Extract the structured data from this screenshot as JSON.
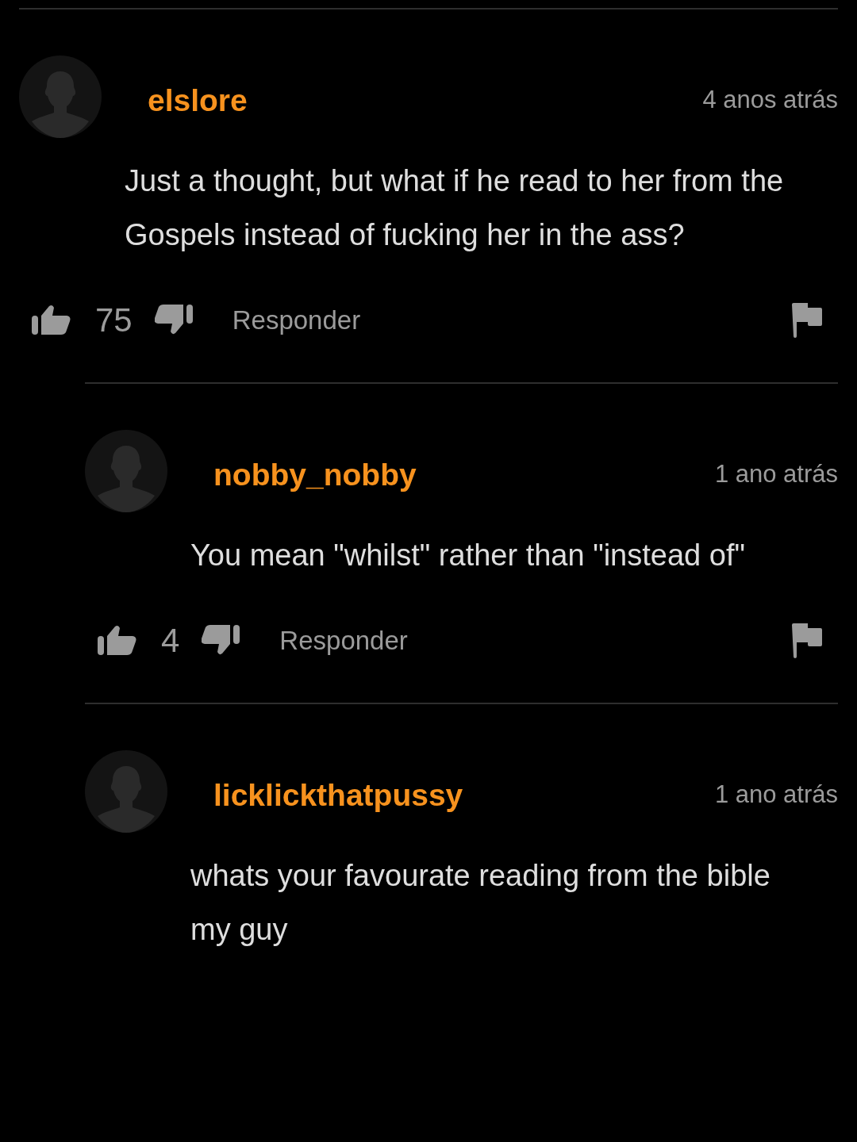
{
  "comments": [
    {
      "username": "elslore",
      "time": "4 anos atrás",
      "text": "Just a thought, but what if he read to her from the Gospels instead of fucking her in the ass?",
      "likes": "75",
      "reply_label": "Responder",
      "children": [
        {
          "username": "nobby_nobby",
          "time": "1 ano atrás",
          "text": "You mean \"whilst\" rather than \"instead of\"",
          "likes": "4",
          "reply_label": "Responder"
        },
        {
          "username": "licklickthatpussy",
          "time": "1 ano atrás",
          "text": "whats your favourate reading from the bible my guy"
        }
      ]
    }
  ]
}
